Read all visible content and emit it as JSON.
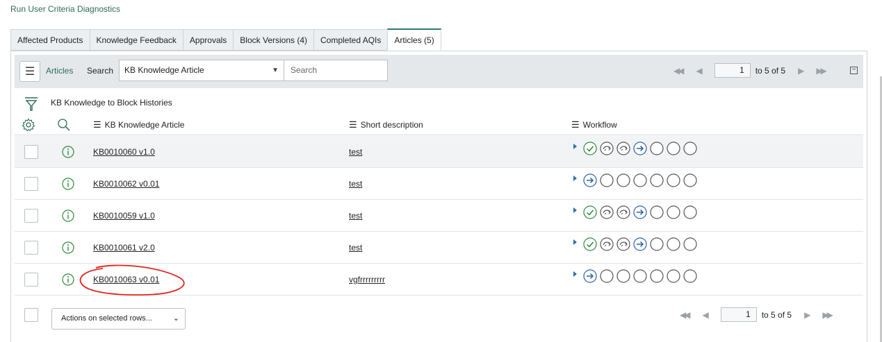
{
  "top_link": "Run User Criteria Diagnostics",
  "tabs": [
    {
      "label": "Affected Products"
    },
    {
      "label": "Knowledge Feedback"
    },
    {
      "label": "Approvals"
    },
    {
      "label": "Block Versions (4)"
    },
    {
      "label": "Completed AQIs"
    },
    {
      "label": "Articles (5)",
      "active": true
    }
  ],
  "toolbar": {
    "title": "Articles",
    "search_label": "Search",
    "search_field_selected": "KB Knowledge Article",
    "search_placeholder": "Search"
  },
  "pager_top": {
    "page": "1",
    "range": "to 5 of 5"
  },
  "breadcrumb": "KB Knowledge to Block Histories",
  "columns": {
    "article": "KB Knowledge Article",
    "short_description": "Short description",
    "workflow": "Workflow"
  },
  "rows": [
    {
      "article": "KB0010060 v1.0",
      "description": "test",
      "workflow": [
        "done",
        "skip",
        "skip",
        "current",
        "empty",
        "empty",
        "empty"
      ]
    },
    {
      "article": "KB0010062 v0.01",
      "description": "test",
      "workflow": [
        "current",
        "empty",
        "empty",
        "empty",
        "empty",
        "empty",
        "empty"
      ]
    },
    {
      "article": "KB0010059 v1.0",
      "description": "test",
      "workflow": [
        "done",
        "skip",
        "skip",
        "current",
        "empty",
        "empty",
        "empty"
      ]
    },
    {
      "article": "KB0010061 v2.0",
      "description": "test",
      "workflow": [
        "done",
        "skip",
        "skip",
        "current",
        "empty",
        "empty",
        "empty"
      ]
    },
    {
      "article": "KB0010063 v0.01",
      "description": "vgfrrrrrrrrr",
      "workflow": [
        "current",
        "empty",
        "empty",
        "empty",
        "empty",
        "empty",
        "empty"
      ]
    }
  ],
  "footer": {
    "actions_label": "Actions on selected rows...",
    "page": "1",
    "range": "to 5 of 5"
  },
  "colors": {
    "accent_teal": "#2e6b5a",
    "done_green": "#2a8a3a",
    "current_blue": "#2c5fa8",
    "annotation_red": "#e0231c"
  }
}
